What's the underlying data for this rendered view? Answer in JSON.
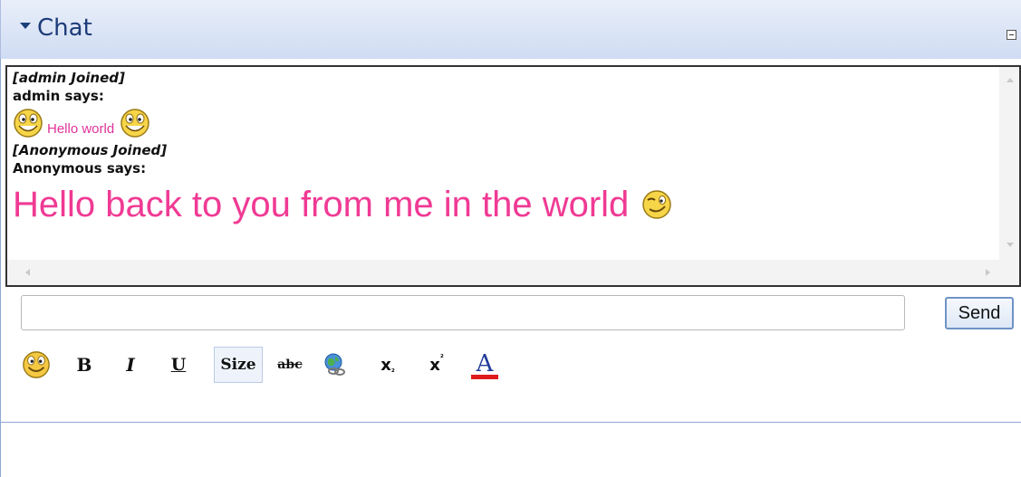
{
  "panel": {
    "title": "Chat"
  },
  "messages": {
    "admin_joined": "[admin Joined]",
    "admin_says": "admin says:",
    "admin_text": "Hello world",
    "anon_joined": "[Anonymous Joined]",
    "anon_says": "Anonymous says:",
    "anon_text": "Hello back to you from me in the world"
  },
  "composer": {
    "value": "",
    "send_label": "Send"
  },
  "toolbar": {
    "bold": "B",
    "italic": "I",
    "underline": "U",
    "size": "Size",
    "strike": "abc",
    "subscript": "x",
    "superscript": "x",
    "font_color": "A"
  },
  "colors": {
    "accent": "#1c3b78",
    "message_pink": "#f03a94",
    "font_color_bar": "#e01b1b"
  }
}
